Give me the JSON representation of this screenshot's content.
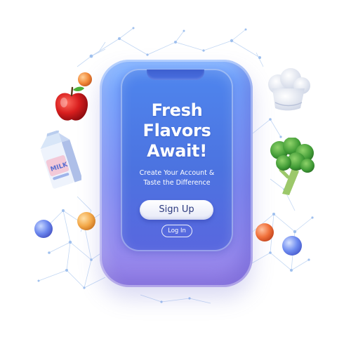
{
  "app": {
    "headline": "Fresh\nFlavors\nAwait!",
    "subheadline": "Create Your Account &\nTaste the Difference",
    "primary_button": "Sign Up",
    "secondary_button": "Log In"
  },
  "decorations": {
    "milk_carton_text": "MILK",
    "icons": [
      "apple-icon",
      "milk-carton-icon",
      "chef-hat-icon",
      "broccoli-icon",
      "orange-sphere-icon",
      "blue-sphere-icon"
    ]
  },
  "colors": {
    "phone_body": "#7f8cf2",
    "screen": "#4c73e0",
    "button_bg": "#ffffff",
    "button_text": "#2d3a7e",
    "text": "#ffffff"
  }
}
